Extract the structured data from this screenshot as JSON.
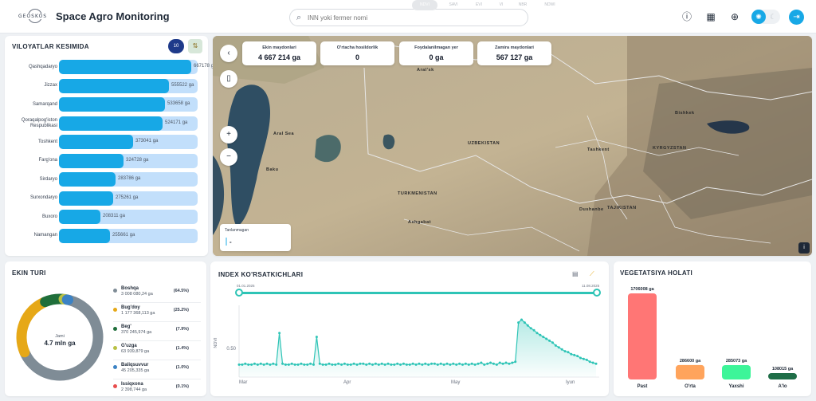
{
  "header": {
    "logo_text": "GEOSKOS",
    "title": "Space Agro Monitoring",
    "search_placeholder": "INN yoki fermer nomi",
    "icons": [
      "info-icon",
      "calendar-icon",
      "globe-icon",
      "sun-icon",
      "moon-icon",
      "logout-icon"
    ]
  },
  "regions": {
    "title": "VILOYATLAR KESIMIDA",
    "count": "10",
    "max": 700000,
    "items": [
      {
        "name": "Qashqadaryo",
        "value": 667178,
        "label": "667178 ga"
      },
      {
        "name": "Jizzax",
        "value": 555522,
        "label": "555522 ga"
      },
      {
        "name": "Samarqand",
        "value": 533658,
        "label": "533658 ga"
      },
      {
        "name": "Qoraqalpog'iston Respublikasi",
        "value": 524171,
        "label": "524171 ga"
      },
      {
        "name": "Toshkent",
        "value": 373041,
        "label": "373041 ga"
      },
      {
        "name": "Farg'ona",
        "value": 324728,
        "label": "324728 ga"
      },
      {
        "name": "Sirdaryo",
        "value": 283786,
        "label": "283786 ga"
      },
      {
        "name": "Surxondaryo",
        "value": 275261,
        "label": "275261 ga"
      },
      {
        "name": "Buxoro",
        "value": 208311,
        "label": "208311 ga"
      },
      {
        "name": "Namangan",
        "value": 255661,
        "label": "255661 ga"
      }
    ]
  },
  "map": {
    "stats": [
      {
        "label": "Ekin maydonlari",
        "value": "4 667 214 ga"
      },
      {
        "label": "O'rtacha hosildorlik",
        "value": "0"
      },
      {
        "label": "Foydalanilmagan yer",
        "value": "0 ga"
      },
      {
        "label": "Zamira maydonlari",
        "value": "567 127 ga"
      }
    ],
    "labels": {
      "uzbekistan": "UZBEKISTAN",
      "turkmenistan": "TURKMENISTAN",
      "kyrgyzstan": "KYRGYZSTAN",
      "tajikistan": "TAJIKISTAN",
      "aral": "Aral Sea",
      "baku": "Baku",
      "tashkent": "Tashkent",
      "bishkek": "Bishkek",
      "dushanbe": "Dushanbe",
      "ashgabat": "Ashgabat",
      "aral_city": "Aral'sk"
    },
    "legend_title": "Tanlanmagan",
    "legend_value": "-"
  },
  "crops": {
    "title": "EKIN TURI",
    "total_label": "Jami",
    "total_value": "4.7 mln ga",
    "items": [
      {
        "name": "Boshqa",
        "area": "3 008 080,24 ga",
        "pct": "(64.5%)",
        "share": 64.5,
        "color": "#7f8c96"
      },
      {
        "name": "Bug'doy",
        "area": "1 177 368,113 ga",
        "pct": "(25.2%)",
        "share": 25.2,
        "color": "#e6a817"
      },
      {
        "name": "Beg'",
        "area": "370 245,974 ga",
        "pct": "(7.9%)",
        "share": 7.9,
        "color": "#1f6e3a"
      },
      {
        "name": "G'uzga",
        "area": "63 939,879 ga",
        "pct": "(1.4%)",
        "share": 1.4,
        "color": "#b8c043"
      },
      {
        "name": "Baliqsuvvur",
        "area": "45 205,335 ga",
        "pct": "(1.0%)",
        "share": 1.0,
        "color": "#3b82c4"
      },
      {
        "name": "Issiqxona",
        "area": "2 398,744 ga",
        "pct": "(0.1%)",
        "share": 0.1,
        "color": "#e84d4d"
      }
    ]
  },
  "index": {
    "title": "INDEX KO'RSATKICHLARI",
    "tabs": [
      "NDVI",
      "SAVI",
      "EVI",
      "VI",
      "NBR",
      "NDWI"
    ],
    "active_tab": "NDVI",
    "range_start": "01.01.2025",
    "range_end": "11.08.2025",
    "ylabel": "NDVI",
    "color": "#2ec4b6"
  },
  "chart_data": [
    {
      "type": "line",
      "title": "INDEX KO'RSATKICHLARI",
      "ylabel": "NDVI",
      "xlabel": "",
      "ylim": [
        0.2,
        0.95
      ],
      "x_ticks": [
        "Mar",
        "Apr",
        "May",
        "Iyun"
      ],
      "y_ticks": [
        0.5
      ],
      "values": [
        0.33,
        0.33,
        0.34,
        0.33,
        0.33,
        0.34,
        0.33,
        0.34,
        0.33,
        0.34,
        0.33,
        0.34,
        0.33,
        0.66,
        0.34,
        0.33,
        0.33,
        0.34,
        0.33,
        0.33,
        0.34,
        0.33,
        0.33,
        0.34,
        0.33,
        0.62,
        0.34,
        0.33,
        0.33,
        0.34,
        0.33,
        0.33,
        0.34,
        0.33,
        0.34,
        0.33,
        0.33,
        0.34,
        0.33,
        0.34,
        0.34,
        0.33,
        0.34,
        0.33,
        0.34,
        0.33,
        0.34,
        0.33,
        0.34,
        0.33,
        0.33,
        0.34,
        0.33,
        0.34,
        0.33,
        0.33,
        0.34,
        0.33,
        0.34,
        0.33,
        0.34,
        0.33,
        0.34,
        0.34,
        0.33,
        0.34,
        0.33,
        0.34,
        0.33,
        0.34,
        0.33,
        0.34,
        0.33,
        0.34,
        0.33,
        0.34,
        0.33,
        0.34,
        0.35,
        0.33,
        0.34,
        0.35,
        0.34,
        0.33,
        0.35,
        0.34,
        0.35,
        0.34,
        0.35,
        0.36,
        0.77,
        0.8,
        0.77,
        0.74,
        0.71,
        0.69,
        0.66,
        0.64,
        0.62,
        0.6,
        0.58,
        0.56,
        0.53,
        0.51,
        0.49,
        0.47,
        0.46,
        0.44,
        0.43,
        0.42,
        0.4,
        0.39,
        0.38,
        0.36,
        0.35,
        0.34
      ]
    },
    {
      "type": "bar",
      "title": "VEGETATSIYA HOLATI",
      "categories": [
        "Past",
        "O'rta",
        "Yaxshi",
        "A'lo"
      ],
      "values": [
        1706008,
        286600,
        285073,
        108015
      ],
      "labels": [
        "1706008 ga",
        "286600 ga",
        "285073 ga",
        "108015 ga"
      ],
      "colors": [
        "#ff7675",
        "#ffa45c",
        "#3df599",
        "#1f6e48"
      ],
      "ylim": [
        0,
        1706008
      ]
    }
  ],
  "vegetation": {
    "title": "VEGETATSIYA HOLATI"
  }
}
